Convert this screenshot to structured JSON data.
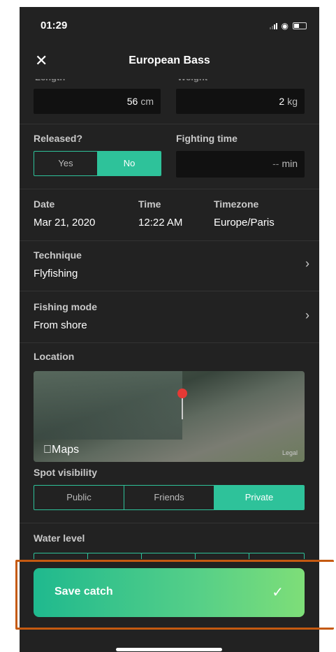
{
  "status": {
    "time": "01:29"
  },
  "nav": {
    "title": "European Bass"
  },
  "measurements": {
    "length_value": "56",
    "length_unit": "cm",
    "weight_value": "2",
    "weight_unit": "kg"
  },
  "released": {
    "label": "Released?",
    "options": [
      "Yes",
      "No"
    ],
    "selected": "No"
  },
  "fighting": {
    "label": "Fighting time",
    "placeholder": "--",
    "unit": "min"
  },
  "datetime": {
    "date_label": "Date",
    "date_value": "Mar 21, 2020",
    "time_label": "Time",
    "time_value": "12:22 AM",
    "tz_label": "Timezone",
    "tz_value": "Europe/Paris"
  },
  "technique": {
    "label": "Technique",
    "value": "Flyfishing"
  },
  "fishing_mode": {
    "label": "Fishing mode",
    "value": "From shore"
  },
  "location": {
    "label": "Location",
    "map_brand": "Maps",
    "map_legal": "Legal"
  },
  "spot_visibility": {
    "label": "Spot visibility",
    "options": [
      "Public",
      "Friends",
      "Private"
    ],
    "selected": "Private"
  },
  "water_level": {
    "label": "Water level"
  },
  "save": {
    "label": "Save catch"
  },
  "colors": {
    "accent": "#2ec29a",
    "background": "#222222",
    "highlight": "#c55a11"
  }
}
